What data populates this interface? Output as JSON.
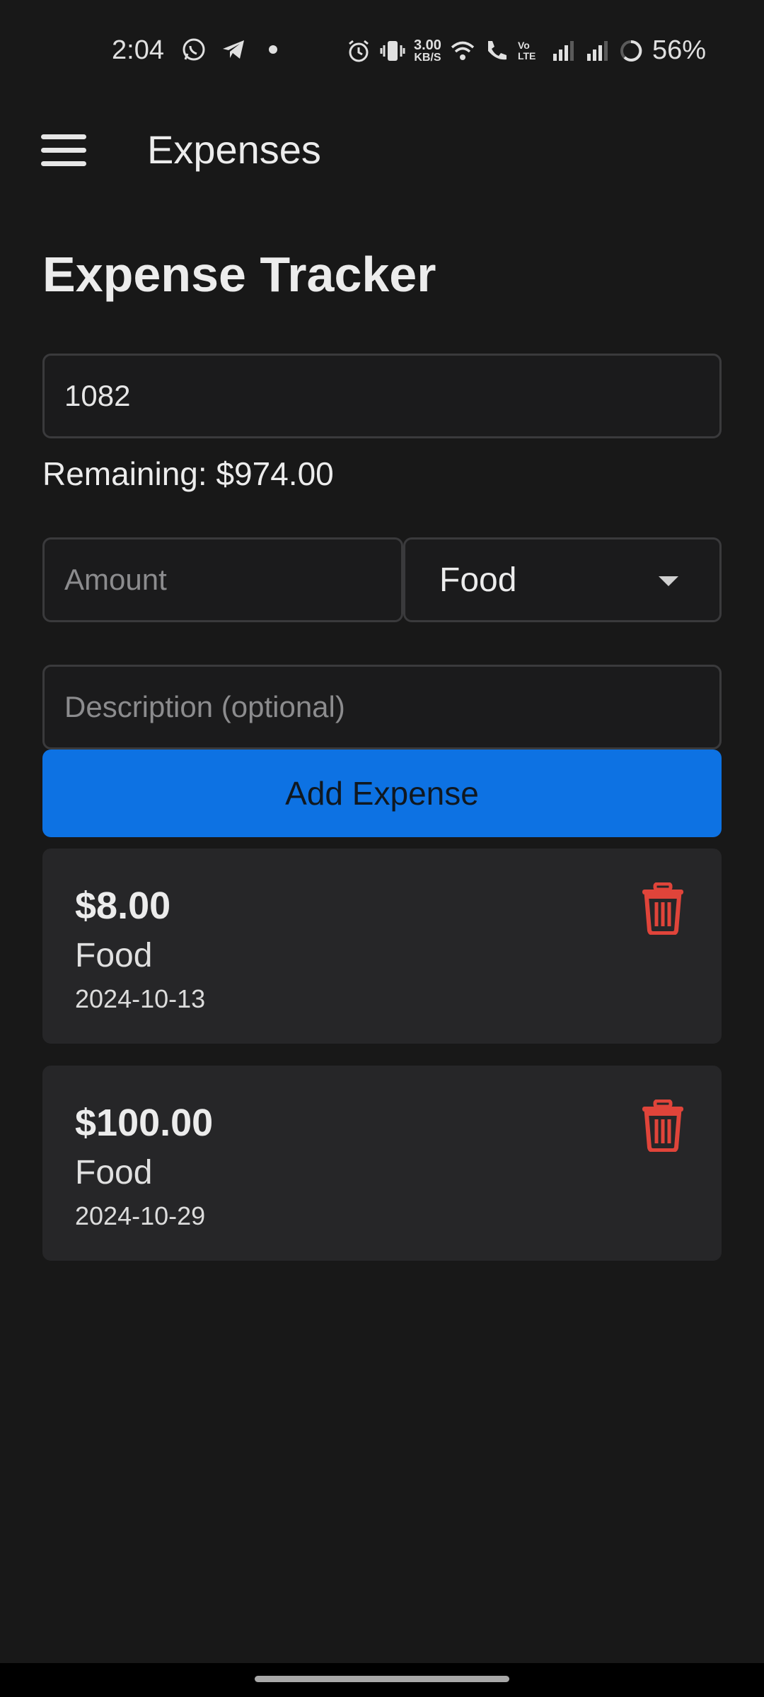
{
  "status_bar": {
    "time": "2:04",
    "net_speed_value": "3.00",
    "net_speed_unit": "KB/S",
    "volte_label": "Vo LTE",
    "battery": "56%",
    "icons": [
      "whatsapp-icon",
      "telegram-icon",
      "dot-icon",
      "alarm-icon",
      "vibrate-icon",
      "wifi-icon",
      "wifi-call-icon",
      "signal-icon",
      "signal-icon",
      "battery-icon"
    ]
  },
  "app_bar": {
    "title": "Expenses",
    "menu_icon": "hamburger-menu-icon"
  },
  "tracker": {
    "title": "Expense Tracker",
    "budget_value": "1082",
    "remaining_text": "Remaining: $974.00",
    "amount_placeholder": "Amount",
    "category_selected": "Food",
    "description_placeholder": "Description (optional)",
    "add_button_label": "Add Expense"
  },
  "expenses": [
    {
      "amount": "$8.00",
      "category": "Food",
      "date": "2024-10-13"
    },
    {
      "amount": "$100.00",
      "category": "Food",
      "date": "2024-10-29"
    }
  ],
  "colors": {
    "background": "#181818",
    "accent": "#0d72e3",
    "card": "#262628",
    "delete": "#e0443a"
  }
}
